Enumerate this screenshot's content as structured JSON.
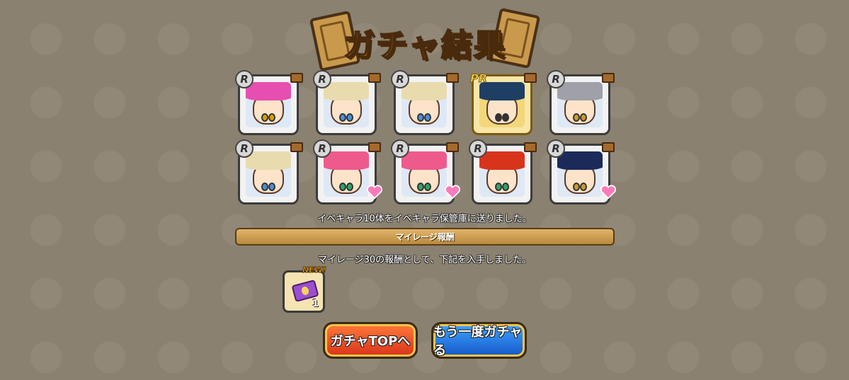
{
  "title": "ガチャ結果",
  "results": [
    {
      "rarity": "R",
      "hair": "#e64fb0",
      "eye": "#d8a000",
      "extra": "chest"
    },
    {
      "rarity": "R",
      "hair": "#e8dcae",
      "eye": "#4a8fd8",
      "extra": "chest"
    },
    {
      "rarity": "R",
      "hair": "#e8dcae",
      "eye": "#4a8fd8",
      "extra": "chest"
    },
    {
      "rarity": "PR",
      "hair": "#1f3e63",
      "eye": "#333333",
      "extra": "chest"
    },
    {
      "rarity": "R",
      "hair": "#9fa0a8",
      "eye": "#c89a30",
      "extra": "chest"
    },
    {
      "rarity": "R",
      "hair": "#e8dcae",
      "eye": "#4a8fd8",
      "extra": "chest"
    },
    {
      "rarity": "R",
      "hair": "#ef5a8c",
      "eye": "#2aa56a",
      "extra": "heart"
    },
    {
      "rarity": "R",
      "hair": "#ef5a8c",
      "eye": "#2aa56a",
      "extra": "heart"
    },
    {
      "rarity": "R",
      "hair": "#d8341c",
      "eye": "#2aa56a",
      "extra": "chest"
    },
    {
      "rarity": "R",
      "hair": "#1c2a5a",
      "eye": "#c89a30",
      "extra": "heart"
    }
  ],
  "notice_sent": "イベキャラ10体をイベキャラ保管庫に送りました。",
  "mileage": {
    "heading": "マイレージ報酬",
    "message": "マイレージ30の報酬として、下記を入手しました。",
    "item": {
      "badge": "NEW!",
      "count": "1",
      "icon": "ticket-icon"
    }
  },
  "buttons": {
    "top": "ガチャTOPへ",
    "again": "もう一度ガチャる"
  }
}
